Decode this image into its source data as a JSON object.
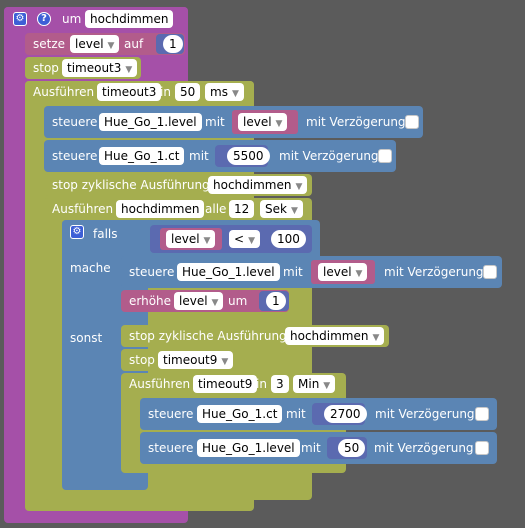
{
  "function": {
    "keyword": "um",
    "name": "hochdimmen"
  },
  "setze": {
    "keyword": "setze",
    "variable": "level",
    "auf": "auf",
    "value": "1"
  },
  "stop_timeout3": {
    "keyword": "stop",
    "name": "timeout3"
  },
  "ausfuehren_timeout3": {
    "keyword": "Ausführen",
    "name": "timeout3",
    "in": "in",
    "delay": "50",
    "unit": "ms"
  },
  "steuere_level1": {
    "keyword": "steuere",
    "object": "Hue_Go_1.level",
    "mit": "mit",
    "value": "level",
    "delay_label": "mit Verzögerung"
  },
  "steuere_ct1": {
    "keyword": "steuere",
    "object": "Hue_Go_1.ct",
    "mit": "mit",
    "value": "5500",
    "delay_label": "mit Verzögerung"
  },
  "stop_zyklisch_1": {
    "keyword": "stop zyklische Ausführung",
    "name": "hochdimmen"
  },
  "ausfuehren_zyklisch": {
    "keyword": "Ausführen",
    "name": "hochdimmen",
    "alle": "alle",
    "interval": "12",
    "unit": "Sek"
  },
  "if_block": {
    "falls": "falls",
    "mache": "mache",
    "sonst": "sonst",
    "var": "level",
    "op": "<",
    "value": "100"
  },
  "steuere_level2": {
    "keyword": "steuere",
    "object": "Hue_Go_1.level",
    "mit": "mit",
    "value": "level",
    "delay_label": "mit Verzögerung"
  },
  "erhoehe": {
    "keyword": "erhöhe",
    "variable": "level",
    "um": "um",
    "value": "1"
  },
  "stop_zyklisch_2": {
    "keyword": "stop zyklische Ausführung",
    "name": "hochdimmen"
  },
  "stop_timeout9": {
    "keyword": "stop",
    "name": "timeout9"
  },
  "ausfuehren_timeout9": {
    "keyword": "Ausführen",
    "name": "timeout9",
    "in": "in",
    "delay": "3",
    "unit": "Min"
  },
  "steuere_ct2": {
    "keyword": "steuere",
    "object": "Hue_Go_1.ct",
    "mit": "mit",
    "value": "2700",
    "delay_label": "mit Verzögerung"
  },
  "steuere_level3": {
    "keyword": "steuere",
    "object": "Hue_Go_1.level",
    "mit": "mit",
    "value": "50",
    "delay_label": "mit Verzögerung"
  },
  "colors": {
    "function": "#a550a8",
    "timer": "#a5ae4f",
    "control": "#5b85b4",
    "variable": "#b25c8b",
    "math": "#5b6ab0",
    "background": "#5b5b5b"
  }
}
